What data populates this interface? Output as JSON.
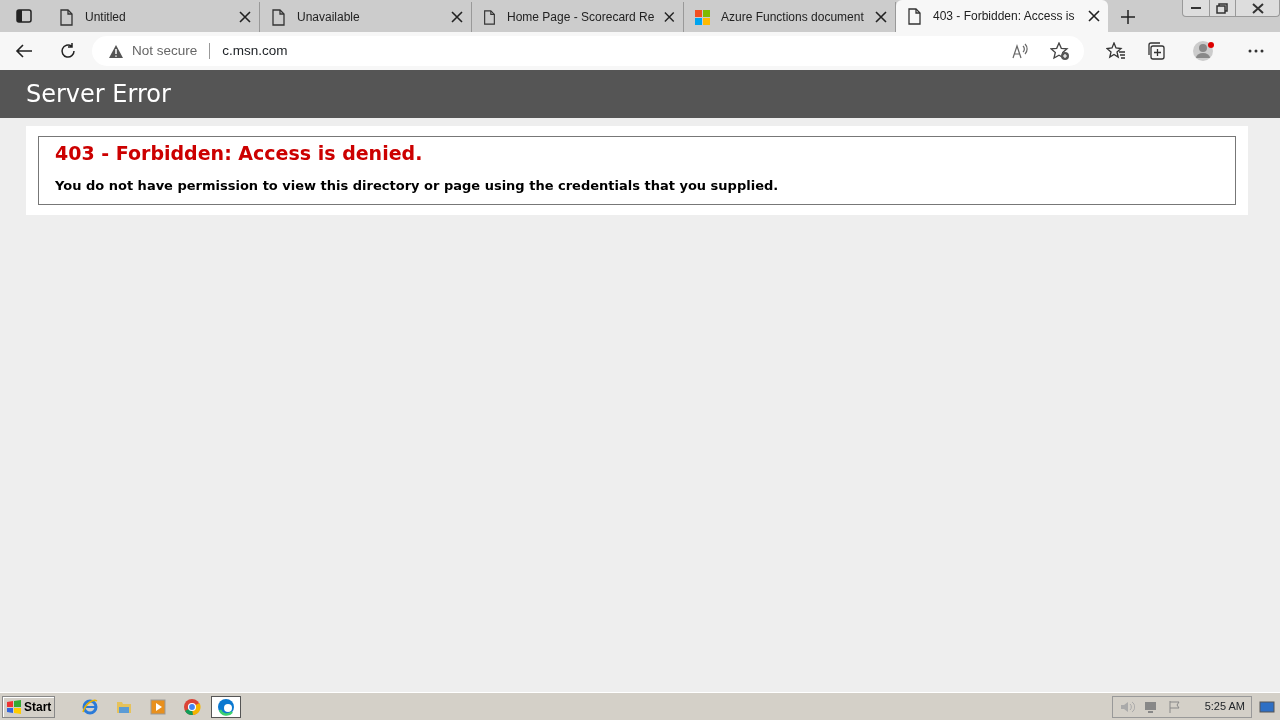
{
  "tabs": [
    {
      "label": "Untitled",
      "kind": "page",
      "selected": false
    },
    {
      "label": "Unavailable",
      "kind": "page",
      "selected": false
    },
    {
      "label": "Home Page - Scorecard Re",
      "kind": "page",
      "selected": false
    },
    {
      "label": "Azure Functions document",
      "kind": "tiles",
      "selected": false
    },
    {
      "label": "403 - Forbidden: Access is",
      "kind": "page",
      "selected": true
    }
  ],
  "address_bar": {
    "security": "Not secure",
    "url": "c.msn.com"
  },
  "page": {
    "header": "Server Error",
    "error_title": "403 - Forbidden: Access is denied.",
    "error_message": "You do not have permission to view this directory or page using the credentials that you supplied."
  },
  "taskbar": {
    "start": "Start",
    "apps": [
      {
        "kind": "ie",
        "selected": false
      },
      {
        "kind": "folder",
        "selected": false
      },
      {
        "kind": "media",
        "selected": false
      },
      {
        "kind": "chrome",
        "selected": false
      },
      {
        "kind": "edge",
        "selected": true
      }
    ],
    "clock": "5:25 AM"
  }
}
